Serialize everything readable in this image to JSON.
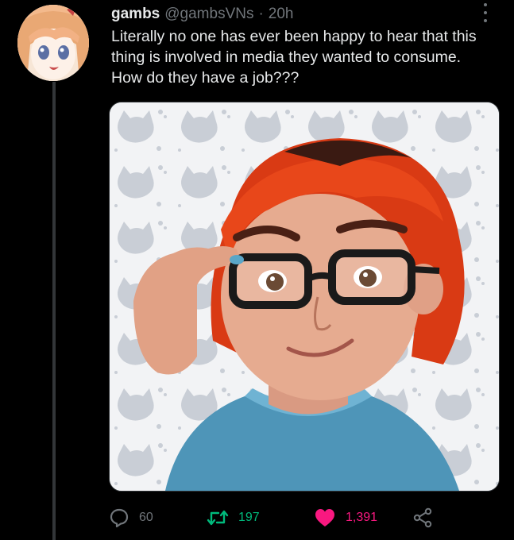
{
  "tweet": {
    "display_name": "gambs",
    "handle": "@gambsVNs",
    "separator": "·",
    "time": "20h",
    "text": "Literally no one has ever been happy to hear that this thing is involved in media they wanted to consume. How do they have a job???"
  },
  "actions": {
    "reply": {
      "icon": "reply-icon",
      "count": "60"
    },
    "retweet": {
      "icon": "retweet-icon",
      "count": "197",
      "active": true
    },
    "like": {
      "icon": "heart-icon",
      "count": "1,391",
      "active": true
    },
    "share": {
      "icon": "share-icon"
    }
  },
  "colors": {
    "background": "#000000",
    "text": "#e7e9ea",
    "muted": "#71767b",
    "retweet_active": "#00ba7c",
    "like_active": "#f91880",
    "thread_line": "#333639"
  }
}
